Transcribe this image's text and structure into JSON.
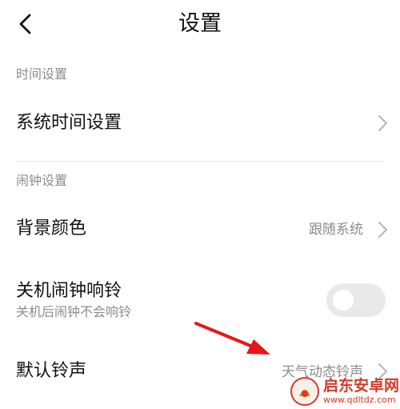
{
  "header": {
    "title": "设置",
    "back_icon": "chevron-left-icon"
  },
  "sections": {
    "time": {
      "title": "时间设置",
      "system_time": {
        "label": "系统时间设置",
        "icon": "chevron-right-icon"
      }
    },
    "alarm": {
      "title": "闹钟设置",
      "background_color": {
        "label": "背景颜色",
        "value": "跟随系统",
        "icon": "chevron-right-icon"
      },
      "shutdown_alarm": {
        "label": "关机闹钟响铃",
        "sublabel": "关机后闹钟不会响铃",
        "enabled": false
      },
      "default_ringtone": {
        "label": "默认铃声",
        "value": "天气动态铃声",
        "icon": "chevron-right-icon"
      }
    }
  },
  "annotation": {
    "type": "red-arrow",
    "color": "#e8161b"
  },
  "watermark": {
    "name": "启东安卓网",
    "url": "www.qdltdz.com",
    "color": "#d23c2a"
  },
  "colors": {
    "background": "#ffffff",
    "text_primary": "#111111",
    "text_secondary": "#8c8c8c",
    "divider": "#e8e8e8",
    "toggle_off": "#e9e9e9"
  }
}
